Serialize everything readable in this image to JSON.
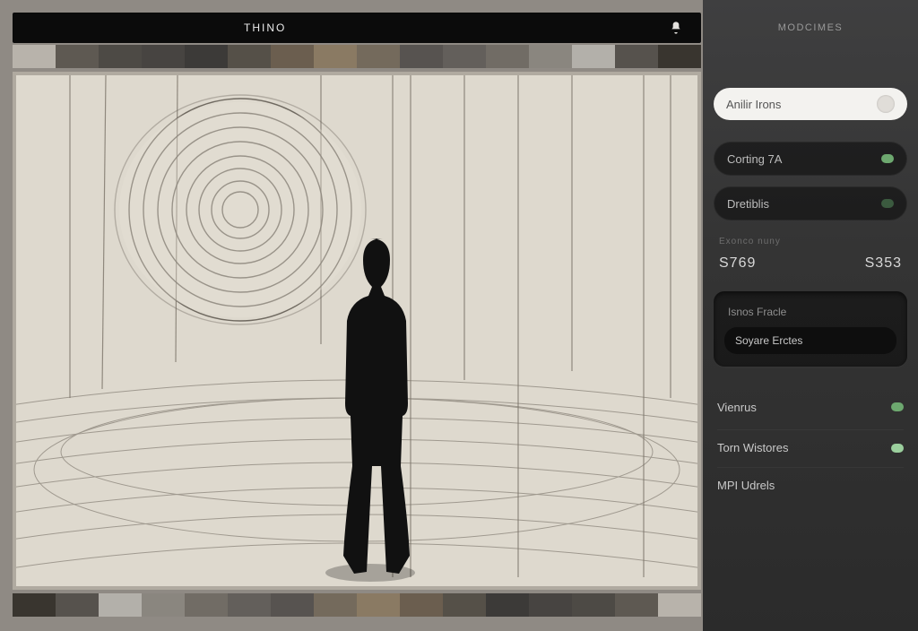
{
  "header": {
    "title": "THINO",
    "section": "MODCIMES"
  },
  "swatches_top": [
    "#b8b3ab",
    "#5e5952",
    "#4d4a45",
    "#474441",
    "#3c3a38",
    "#555048",
    "#6b5e4f",
    "#8a7a63",
    "#746a5c",
    "#575350",
    "#635f5b",
    "#716c65",
    "#8a867f",
    "#b3b0aa",
    "#56524d",
    "#39352f"
  ],
  "swatches_bottom": [
    "#39352f",
    "#56524d",
    "#b3b0aa",
    "#8a867f",
    "#716c65",
    "#635f5b",
    "#575350",
    "#746a5c",
    "#8a7a63",
    "#6b5e4f",
    "#555048",
    "#3c3a38",
    "#474441",
    "#4d4a45",
    "#5e5952",
    "#b8b3ab"
  ],
  "controls": {
    "search_placeholder": "Anilir Irons",
    "toggle1": {
      "label": "Corting 7A",
      "on": true
    },
    "toggle2": {
      "label": "Dretiblis",
      "on": false
    },
    "stats_header": "Exonco nuny",
    "stat_left": "S769",
    "stat_right": "S353",
    "panel_label": "Isnos Fracle",
    "panel_button": "Soyare Erctes",
    "rows": [
      {
        "label": "Vienrus",
        "ind": "green"
      },
      {
        "label": "Torn Wistores",
        "ind": "lgreen"
      },
      {
        "label": "MPI Udrels",
        "ind": "none"
      }
    ]
  }
}
